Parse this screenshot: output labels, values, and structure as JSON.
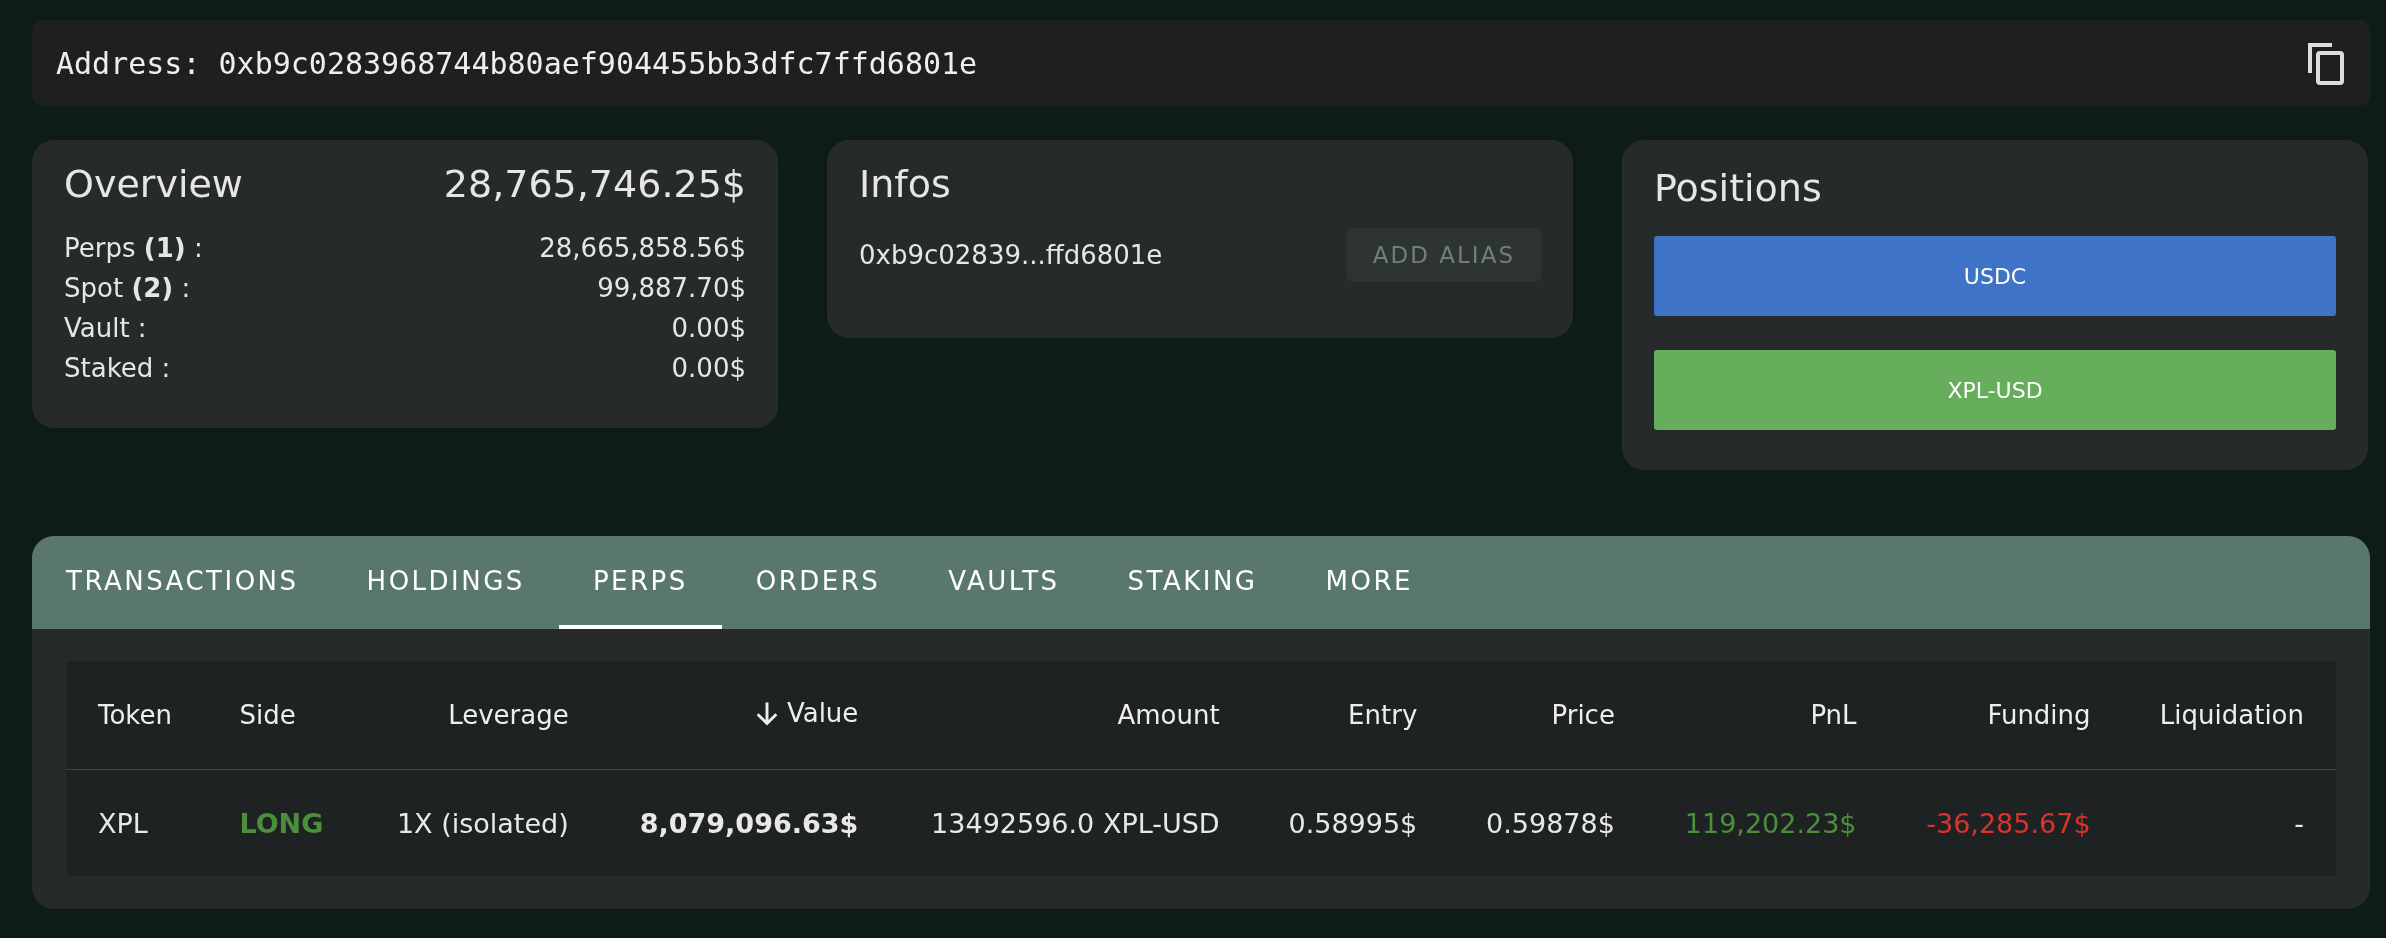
{
  "address_bar": {
    "label": "Address:",
    "value": "0xb9c0283968744b80aef904455bb3dfc7ffd6801e"
  },
  "overview": {
    "title": "Overview",
    "total": "28,765,746.25$",
    "rows": [
      {
        "label": "Perps **(1)** :",
        "value": "28,665,858.56$"
      },
      {
        "label": "Spot **(2)** :",
        "value": "99,887.70$"
      },
      {
        "label": "Vault :",
        "value": "0.00$"
      },
      {
        "label": "Staked :",
        "value": "0.00$"
      }
    ]
  },
  "infos": {
    "title": "Infos",
    "address": "0xb9c02839...ffd6801e",
    "button": {
      "label": "ADD ALIAS",
      "disabled": true
    }
  },
  "positions": {
    "title": "Positions",
    "items": [
      {
        "label": "USDC",
        "color": "#3f73c8"
      },
      {
        "label": "XPL-USD",
        "color": "#66ad5c"
      }
    ]
  },
  "tabs": [
    {
      "label": "TRANSACTIONS",
      "selected": false
    },
    {
      "label": "HOLDINGS",
      "selected": false
    },
    {
      "label": "PERPS",
      "selected": true
    },
    {
      "label": "ORDERS",
      "selected": false
    },
    {
      "label": "VAULTS",
      "selected": false
    },
    {
      "label": "STAKING",
      "selected": false
    },
    {
      "label": "MORE",
      "selected": false
    }
  ],
  "table": {
    "columns": [
      {
        "label": "Token",
        "sorted": false
      },
      {
        "label": "Side",
        "sorted": false
      },
      {
        "label": "Leverage",
        "sorted": false
      },
      {
        "label": "Value",
        "sorted": true
      },
      {
        "label": "Amount",
        "sorted": false
      },
      {
        "label": "Entry",
        "sorted": false
      },
      {
        "label": "Price",
        "sorted": false
      },
      {
        "label": "PnL",
        "sorted": false
      },
      {
        "label": "Funding",
        "sorted": false
      },
      {
        "label": "Liquidation",
        "sorted": false
      }
    ],
    "rows": [
      [
        {
          "text": "XPL",
          "bold": false
        },
        {
          "text": "LONG",
          "color": "#4c8f3a",
          "bold": true
        },
        {
          "text": "1X (isolated)",
          "bold": false
        },
        {
          "text": "8,079,096.63$",
          "bold": true
        },
        {
          "text": "13492596.0 XPL-USD",
          "bold": false
        },
        {
          "text": "0.58995$",
          "bold": false
        },
        {
          "text": "0.59878$",
          "bold": false
        },
        {
          "text": "119,202.23$",
          "color": "#4c8f3a",
          "bold": false
        },
        {
          "text": "-36,285.67$",
          "color": "#d9332b",
          "bold": false
        },
        {
          "text": "-",
          "bold": false
        }
      ]
    ]
  }
}
